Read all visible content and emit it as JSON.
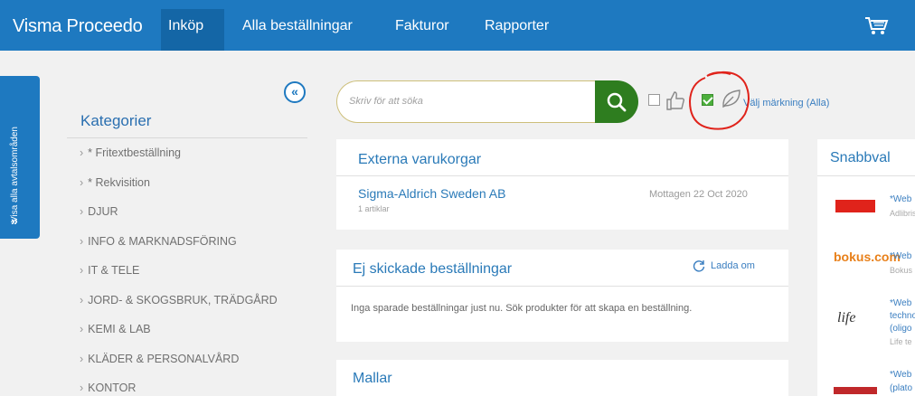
{
  "app": {
    "brand": "Visma Proceedo",
    "nav": [
      "Inköp",
      "Alla beställningar",
      "Fakturor",
      "Rapporter"
    ],
    "cart_icon": "cart-icon"
  },
  "sidetab": {
    "label": "Visa alla avtalsområden",
    "chevron": "»"
  },
  "categories": {
    "title": "Kategorier",
    "collapse_glyph": "«",
    "items": [
      "* Fritextbeställning",
      "* Rekvisition",
      "DJUR",
      "INFO & MARKNADSFÖRING",
      "IT & TELE",
      "JORD- & SKOGSBRUK, TRÄDGÅRD",
      "KEMI & LAB",
      "KLÄDER & PERSONALVÅRD",
      "KONTOR"
    ]
  },
  "search": {
    "placeholder": "Skriv för att söka",
    "marking_label": "Välj märkning (Alla)"
  },
  "external_carts": {
    "title": "Externa varukorgar",
    "supplier": "Sigma-Aldrich Sweden AB",
    "items": "1 artiklar",
    "received": "Mottagen 22 Oct 2020"
  },
  "unsent_orders": {
    "title": "Ej skickade beställningar",
    "reload": "Ladda om",
    "empty": "Inga sparade beställningar just nu. Sök produkter för att skapa en beställning."
  },
  "templates": {
    "title": "Mallar"
  },
  "snabbval": {
    "title": "Snabbval",
    "items": [
      {
        "link": "*Web",
        "sub": "Adlibris"
      },
      {
        "link": "*Web",
        "sub": "Bokus",
        "logo": "bokus.com"
      },
      {
        "link": "*Web",
        "line2": "techno",
        "line3": "(oligo",
        "sub": "Life te",
        "logo": "life"
      },
      {
        "link": "*Web",
        "line2": "(plato"
      }
    ]
  },
  "colors": {
    "header": "#1e79c0",
    "accent_green": "#2e7d1f",
    "link": "#2a7ab8",
    "annotation_red": "#e0231b"
  }
}
